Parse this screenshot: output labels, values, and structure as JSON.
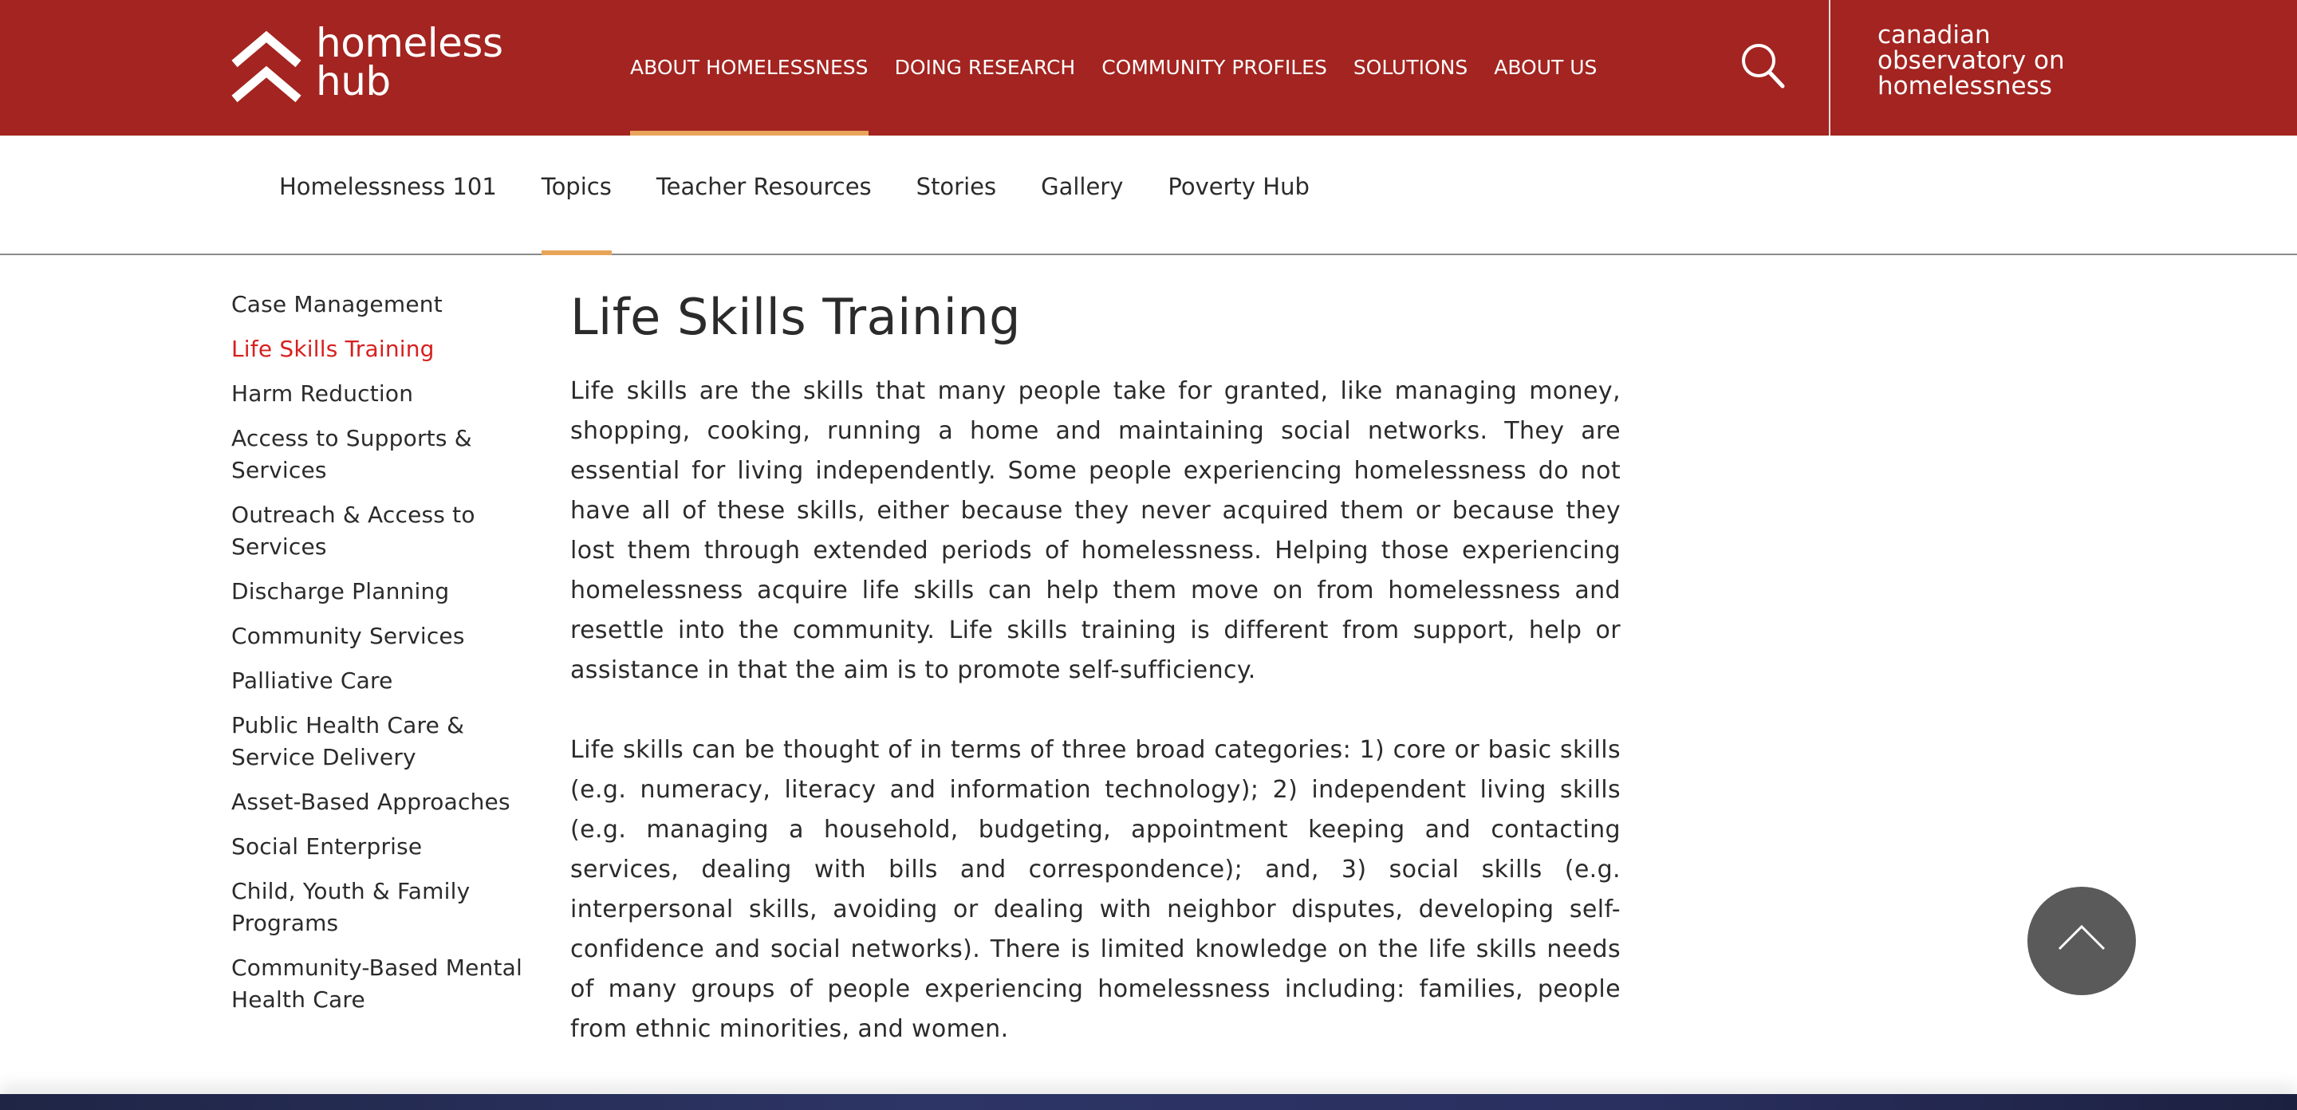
{
  "brand": {
    "logo_text": "homeless\nhub",
    "partner_text": "canadian\nobservatory on\nhomelessness",
    "header_color": "#a32420",
    "accent_color": "#e8a55a",
    "active_link_color": "#d7201f"
  },
  "main_nav": [
    {
      "label": "ABOUT HOMELESSNESS",
      "active": true
    },
    {
      "label": "DOING RESEARCH"
    },
    {
      "label": "COMMUNITY PROFILES"
    },
    {
      "label": "SOLUTIONS"
    },
    {
      "label": "ABOUT US"
    }
  ],
  "search_icon": "search-icon",
  "sub_nav": [
    {
      "label": "Homelessness 101"
    },
    {
      "label": "Topics",
      "active": true
    },
    {
      "label": "Teacher Resources"
    },
    {
      "label": "Stories"
    },
    {
      "label": "Gallery"
    },
    {
      "label": "Poverty Hub"
    }
  ],
  "sidebar": [
    {
      "label": "Case Management"
    },
    {
      "label": "Life Skills Training",
      "active": true
    },
    {
      "label": "Harm Reduction"
    },
    {
      "label": "Access to Supports & Services"
    },
    {
      "label": "Outreach & Access to Services"
    },
    {
      "label": "Discharge Planning"
    },
    {
      "label": "Community Services"
    },
    {
      "label": "Palliative Care"
    },
    {
      "label": "Public Health Care & Service Delivery"
    },
    {
      "label": "Asset-Based Approaches"
    },
    {
      "label": "Social Enterprise"
    },
    {
      "label": "Child, Youth & Family Programs"
    },
    {
      "label": "Community-Based Mental Health Care"
    }
  ],
  "article": {
    "title": "Life Skills Training",
    "paragraphs": [
      "Life skills are the skills that many people take for granted, like managing money, shopping, cooking, running a home and maintaining social networks. They are essential for living independently. Some  people experiencing homelessness do not have all of these skills, either because they never acquired them or because they lost them through extended periods of homelessness. Helping those experiencing homelessness acquire life skills can help them move on from homelessness and resettle into the community. Life skills training is different from support, help or assistance in that the aim is to promote self-sufficiency.",
      "Life skills can be thought of in terms of three broad categories: 1) core or basic skills (e.g. numeracy, literacy and information technology); 2) independent living skills (e.g. managing a household, budgeting, appointment keeping and contacting services, dealing with bills and correspondence); and, 3) social skills (e.g. interpersonal skills, avoiding or dealing with neighbor disputes, developing self-confidence and social networks). There is limited knowledge on the life skills needs of many groups of people experiencing homelessness including: families, people from ethnic minorities, and women."
    ]
  },
  "back_to_top_icon": "chevron-up-icon"
}
